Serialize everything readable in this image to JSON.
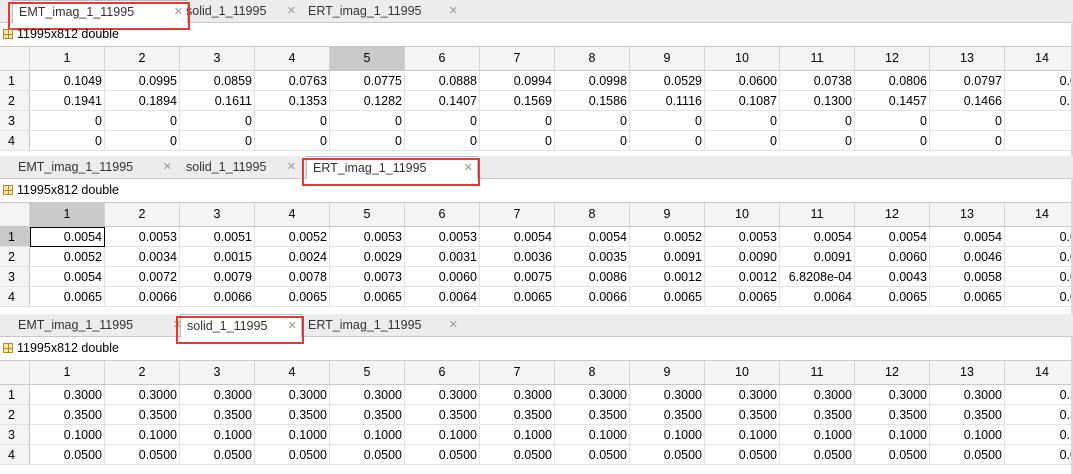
{
  "panels": [
    {
      "tabs": [
        {
          "label": "EMT_imag_1_11995",
          "close": "✕"
        },
        {
          "label": "solid_1_11995",
          "close": "✕"
        },
        {
          "label": "ERT_imag_1_11995",
          "close": "✕"
        }
      ],
      "active_tab": 0,
      "info": "11995x812 double",
      "selected_col": "5",
      "selected_row": "",
      "columns": [
        "1",
        "2",
        "3",
        "4",
        "5",
        "6",
        "7",
        "8",
        "9",
        "10",
        "11",
        "12",
        "13",
        "14"
      ],
      "rows": [
        {
          "id": "1",
          "values": [
            "0.1049",
            "0.0995",
            "0.0859",
            "0.0763",
            "0.0775",
            "0.0888",
            "0.0994",
            "0.0998",
            "0.0529",
            "0.0600",
            "0.0738",
            "0.0806",
            "0.0797",
            "0.0"
          ]
        },
        {
          "id": "2",
          "values": [
            "0.1941",
            "0.1894",
            "0.1611",
            "0.1353",
            "0.1282",
            "0.1407",
            "0.1569",
            "0.1586",
            "0.1116",
            "0.1087",
            "0.1300",
            "0.1457",
            "0.1466",
            "0.1"
          ]
        },
        {
          "id": "3",
          "values": [
            "0",
            "0",
            "0",
            "0",
            "0",
            "0",
            "0",
            "0",
            "0",
            "0",
            "0",
            "0",
            "0",
            ""
          ]
        },
        {
          "id": "4",
          "values": [
            "0",
            "0",
            "0",
            "0",
            "0",
            "0",
            "0",
            "0",
            "0",
            "0",
            "0",
            "0",
            "0",
            ""
          ]
        }
      ]
    },
    {
      "tabs": [
        {
          "label": "EMT_imag_1_11995",
          "close": "✕"
        },
        {
          "label": "solid_1_11995",
          "close": "✕"
        },
        {
          "label": "ERT_imag_1_11995",
          "close": "✕"
        }
      ],
      "active_tab": 2,
      "info": "11995x812 double",
      "selected_col": "1",
      "selected_row": "1",
      "columns": [
        "1",
        "2",
        "3",
        "4",
        "5",
        "6",
        "7",
        "8",
        "9",
        "10",
        "11",
        "12",
        "13",
        "14"
      ],
      "rows": [
        {
          "id": "1",
          "values": [
            "0.0054",
            "0.0053",
            "0.0051",
            "0.0052",
            "0.0053",
            "0.0053",
            "0.0054",
            "0.0054",
            "0.0052",
            "0.0053",
            "0.0054",
            "0.0054",
            "0.0054",
            "0.0"
          ]
        },
        {
          "id": "2",
          "values": [
            "0.0052",
            "0.0034",
            "0.0015",
            "0.0024",
            "0.0029",
            "0.0031",
            "0.0036",
            "0.0035",
            "0.0091",
            "0.0090",
            "0.0091",
            "0.0060",
            "0.0046",
            "0.0"
          ]
        },
        {
          "id": "3",
          "values": [
            "0.0054",
            "0.0072",
            "0.0079",
            "0.0078",
            "0.0073",
            "0.0060",
            "0.0075",
            "0.0086",
            "0.0012",
            "0.0012",
            "6.8208e-04",
            "0.0043",
            "0.0058",
            "0.0"
          ]
        },
        {
          "id": "4",
          "values": [
            "0.0065",
            "0.0066",
            "0.0066",
            "0.0065",
            "0.0065",
            "0.0064",
            "0.0065",
            "0.0066",
            "0.0065",
            "0.0065",
            "0.0064",
            "0.0065",
            "0.0065",
            "0.0"
          ]
        }
      ]
    },
    {
      "tabs": [
        {
          "label": "EMT_imag_1_11995",
          "close": "✕"
        },
        {
          "label": "solid_1_11995",
          "close": "✕"
        },
        {
          "label": "ERT_imag_1_11995",
          "close": "✕"
        }
      ],
      "active_tab": 1,
      "info": "11995x812 double",
      "selected_col": "",
      "selected_row": "",
      "columns": [
        "1",
        "2",
        "3",
        "4",
        "5",
        "6",
        "7",
        "8",
        "9",
        "10",
        "11",
        "12",
        "13",
        "14"
      ],
      "rows": [
        {
          "id": "1",
          "values": [
            "0.3000",
            "0.3000",
            "0.3000",
            "0.3000",
            "0.3000",
            "0.3000",
            "0.3000",
            "0.3000",
            "0.3000",
            "0.3000",
            "0.3000",
            "0.3000",
            "0.3000",
            "0.3"
          ]
        },
        {
          "id": "2",
          "values": [
            "0.3500",
            "0.3500",
            "0.3500",
            "0.3500",
            "0.3500",
            "0.3500",
            "0.3500",
            "0.3500",
            "0.3500",
            "0.3500",
            "0.3500",
            "0.3500",
            "0.3500",
            "0.3"
          ]
        },
        {
          "id": "3",
          "values": [
            "0.1000",
            "0.1000",
            "0.1000",
            "0.1000",
            "0.1000",
            "0.1000",
            "0.1000",
            "0.1000",
            "0.1000",
            "0.1000",
            "0.1000",
            "0.1000",
            "0.1000",
            "0.1"
          ]
        },
        {
          "id": "4",
          "values": [
            "0.0500",
            "0.0500",
            "0.0500",
            "0.0500",
            "0.0500",
            "0.0500",
            "0.0500",
            "0.0500",
            "0.0500",
            "0.0500",
            "0.0500",
            "0.0500",
            "0.0500",
            "0.0"
          ]
        }
      ]
    }
  ],
  "colors": {
    "highlight_box": "#e53935",
    "header_bg": "#f4f4f4",
    "selected_bg": "#c9c9c9"
  }
}
